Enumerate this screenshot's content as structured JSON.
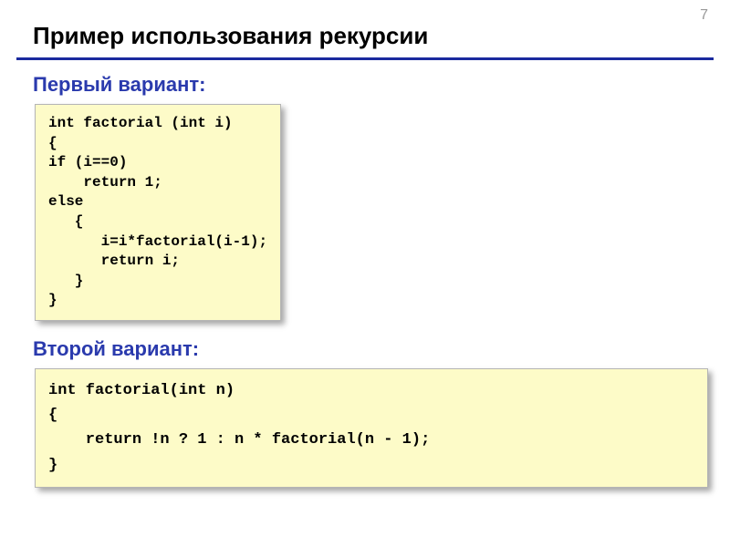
{
  "page_number": "7",
  "slide_title": "Пример использования рекурсии",
  "variant1_label": "Первый вариант:",
  "variant2_label": "Второй вариант:",
  "code1": "int factorial (int i)\n{\nif (i==0)\n    return 1;\nelse\n   {\n      i=i*factorial(i-1);\n      return i;\n   }\n}",
  "code2": "int factorial(int n)\n{\n    return !n ? 1 : n * factorial(n - 1);\n}"
}
